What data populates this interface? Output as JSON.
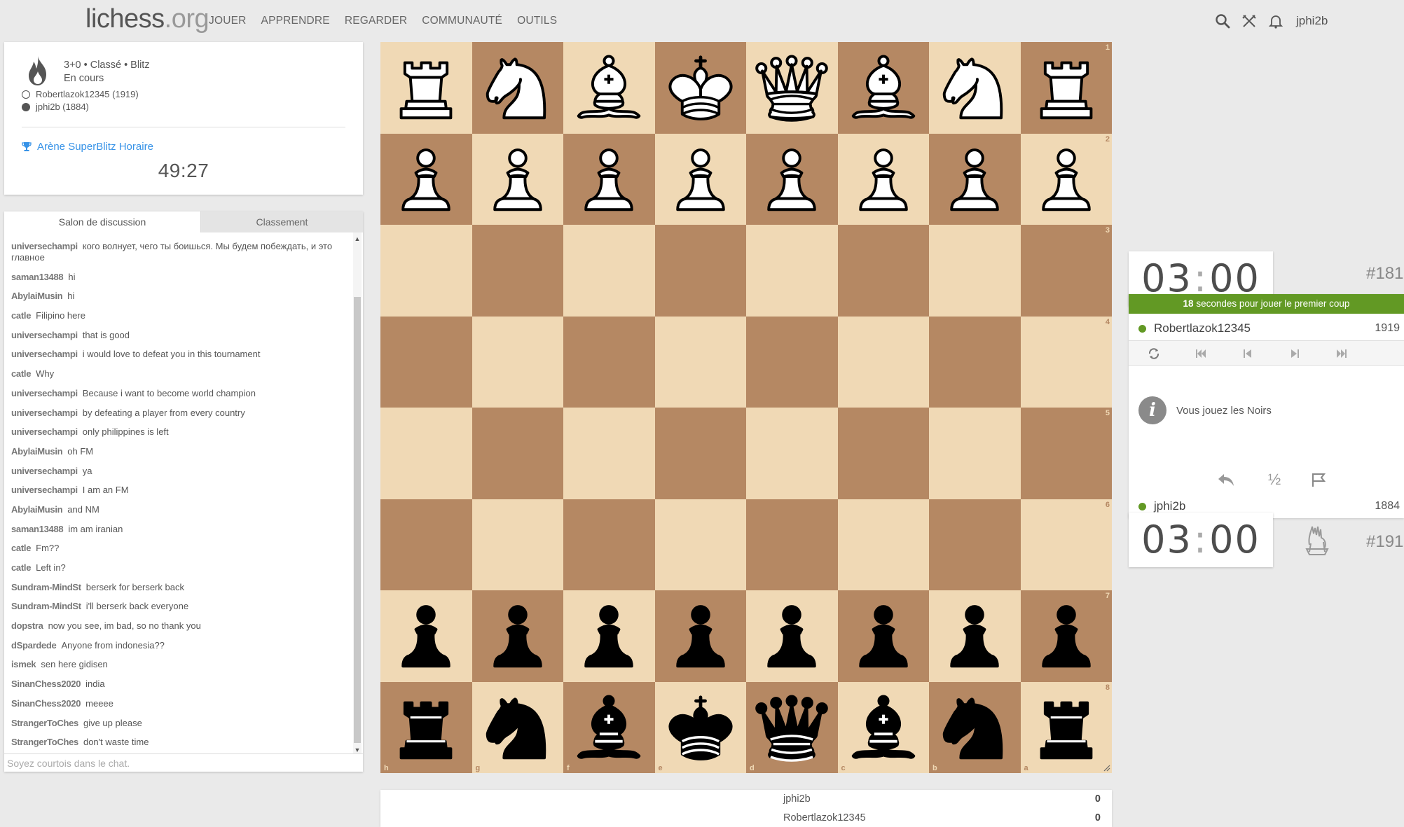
{
  "nav": {
    "logo_main": "lichess",
    "logo_suffix": ".org",
    "links": [
      "JOUER",
      "APPRENDRE",
      "REGARDER",
      "COMMUNAUTÉ",
      "OUTILS"
    ],
    "username": "jphi2b"
  },
  "game": {
    "setup": "3+0 • Classé • Blitz",
    "status": "En cours",
    "white_player": "Robertlazok12345 (1919)",
    "black_player": "jphi2b (1884)",
    "tournament": "Arène SuperBlitz Horaire",
    "tournament_clock": "49:27"
  },
  "chat": {
    "tab_active": "Salon de discussion",
    "tab_other": "Classement",
    "placeholder": "Soyez courtois dans le chat.",
    "messages": [
      {
        "user": "universechampi",
        "text": "кого волнует, чего ты боишься. Мы будем побеждать, и это главное"
      },
      {
        "user": "saman13488",
        "text": "hi"
      },
      {
        "user": "AbylaiMusin",
        "text": "hi"
      },
      {
        "user": "catle",
        "text": "Filipino here"
      },
      {
        "user": "universechampi",
        "text": "that is good"
      },
      {
        "user": "universechampi",
        "text": "i would love to defeat you in this tournament"
      },
      {
        "user": "catle",
        "text": "Why"
      },
      {
        "user": "universechampi",
        "text": "Because i want to become world champion"
      },
      {
        "user": "universechampi",
        "text": "by defeating a player from every country"
      },
      {
        "user": "universechampi",
        "text": "only philippines is left"
      },
      {
        "user": "AbylaiMusin",
        "text": "oh FM"
      },
      {
        "user": "universechampi",
        "text": "ya"
      },
      {
        "user": "universechampi",
        "text": "I am an FM"
      },
      {
        "user": "AbylaiMusin",
        "text": "and NM"
      },
      {
        "user": "saman13488",
        "text": "im am iranian"
      },
      {
        "user": "catle",
        "text": "Fm??"
      },
      {
        "user": "catle",
        "text": "Left in?"
      },
      {
        "user": "Sundram-MindSt",
        "text": "berserk for berserk back"
      },
      {
        "user": "Sundram-MindSt",
        "text": "i'll berserk back everyone"
      },
      {
        "user": "dopstra",
        "text": "now you see, im bad, so no thank you"
      },
      {
        "user": "dSpardede",
        "text": "Anyone from indonesia??"
      },
      {
        "user": "ismek",
        "text": "sen here gidisen"
      },
      {
        "user": "SinanChess2020",
        "text": "india"
      },
      {
        "user": "SinanChess2020",
        "text": "meeee"
      },
      {
        "user": "StrangerToChes",
        "text": "give up please"
      },
      {
        "user": "StrangerToChes",
        "text": "don't waste time"
      }
    ]
  },
  "board": {
    "orientation": "black",
    "ranks_top_to_bottom": [
      "1",
      "2",
      "3",
      "4",
      "5",
      "6",
      "7",
      "8"
    ],
    "files_left_to_right": [
      "h",
      "g",
      "f",
      "e",
      "d",
      "c",
      "b",
      "a"
    ],
    "rows": [
      [
        "wR",
        "wN",
        "wB",
        "wK",
        "wQ",
        "wB",
        "wN",
        "wR"
      ],
      [
        "wP",
        "wP",
        "wP",
        "wP",
        "wP",
        "wP",
        "wP",
        "wP"
      ],
      [
        "",
        "",
        "",
        "",
        "",
        "",
        "",
        ""
      ],
      [
        "",
        "",
        "",
        "",
        "",
        "",
        "",
        ""
      ],
      [
        "",
        "",
        "",
        "",
        "",
        "",
        "",
        ""
      ],
      [
        "",
        "",
        "",
        "",
        "",
        "",
        "",
        ""
      ],
      [
        "bP",
        "bP",
        "bP",
        "bP",
        "bP",
        "bP",
        "bP",
        "bP"
      ],
      [
        "bR",
        "bN",
        "bB",
        "bK",
        "bQ",
        "bB",
        "bN",
        "bR"
      ]
    ],
    "light_color": "#f0d9b5",
    "dark_color": "#b58863"
  },
  "right": {
    "top_clock_min": "03",
    "top_clock_sec": "00",
    "top_rank": "#181",
    "first_move_secs": "18",
    "first_move_text": " secondes pour jouer le premier coup",
    "opponent_name": "Robertlazok12345",
    "opponent_rating": "1919",
    "info_text": "Vous jouez les Noirs",
    "draw_label": "½",
    "me_name": "jphi2b",
    "me_rating": "1884",
    "bot_clock_min": "03",
    "bot_clock_sec": "00",
    "bot_rank": "#191",
    "accent": "#629924"
  },
  "standings": [
    {
      "name": "jphi2b",
      "score": "0"
    },
    {
      "name": "Robertlazok12345",
      "score": "0"
    }
  ]
}
